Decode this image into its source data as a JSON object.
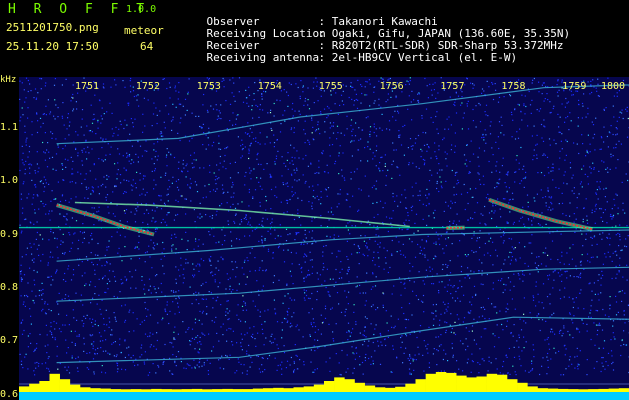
{
  "header": {
    "title": "H R O F F T",
    "version": "1.0.0",
    "filename": "2511201750.png",
    "datetime": "25.11.20 17:50",
    "meteor_label": "meteor",
    "meteor_count": "64"
  },
  "metadata": [
    {
      "key": "Observer",
      "value": ": Takanori Kawachi"
    },
    {
      "key": "Receiving Location",
      "value": ": Ogaki, Gifu, JAPAN (136.60E, 35.35N)"
    },
    {
      "key": "Receiver",
      "value": ": R820T2(RTL-SDR) SDR-Sharp 53.372MHz"
    },
    {
      "key": "Receiving antenna",
      "value": ": 2el-HB9CV Vertical (el. E-W)"
    }
  ],
  "colors": {
    "title": "#7CFC00",
    "labels": "#FFFF66",
    "text": "#FFFFFF",
    "background": "#06064e",
    "trace": "#00E0B0",
    "meteor_head": "#FF3030",
    "level_bar": "#FFFF00",
    "level_base": "#00CCFF"
  },
  "chart_data": {
    "type": "heatmap",
    "xlabel": "",
    "ylabel": "kHz",
    "x_ticks": [
      "1751",
      "1752",
      "1753",
      "1754",
      "1755",
      "1756",
      "1757",
      "1758",
      "1759",
      "1800"
    ],
    "y_ticks": [
      "1.1",
      "1.0",
      "0.9",
      "0.8",
      "0.7",
      "0.6"
    ],
    "ylim": [
      0.59,
      1.195
    ],
    "carrier_khz": 0.913,
    "horizontal_lines_khz": [
      0.913,
      0.62
    ],
    "traces": [
      {
        "points": [
          [
            0.0,
            1.07
          ],
          [
            2.0,
            1.08
          ],
          [
            4.0,
            1.12
          ],
          [
            6.0,
            1.145
          ],
          [
            8.0,
            1.175
          ],
          [
            9.3,
            1.18
          ],
          [
            10.0,
            1.18
          ]
        ]
      },
      {
        "points": [
          [
            0.0,
            0.85
          ],
          [
            2.5,
            0.87
          ],
          [
            4.5,
            0.89
          ],
          [
            6.0,
            0.9
          ],
          [
            8.0,
            0.905
          ],
          [
            10.0,
            0.91
          ]
        ]
      },
      {
        "points": [
          [
            0.0,
            0.775
          ],
          [
            3.0,
            0.79
          ],
          [
            6.0,
            0.82
          ],
          [
            8.0,
            0.835
          ],
          [
            10.0,
            0.84
          ]
        ]
      },
      {
        "points": [
          [
            0.0,
            0.66
          ],
          [
            3.0,
            0.67
          ],
          [
            4.3,
            0.69
          ],
          [
            6.0,
            0.72
          ],
          [
            7.5,
            0.745
          ],
          [
            10.0,
            0.74
          ]
        ]
      },
      {
        "points": [
          [
            0.3,
            0.96
          ],
          [
            1.5,
            0.955
          ],
          [
            3.0,
            0.945
          ],
          [
            4.5,
            0.93
          ],
          [
            5.8,
            0.915
          ]
        ]
      }
    ],
    "meteors": [
      {
        "points": [
          [
            0.0,
            0.955
          ],
          [
            0.6,
            0.935
          ],
          [
            1.1,
            0.915
          ],
          [
            1.6,
            0.9
          ]
        ]
      },
      {
        "points": [
          [
            7.1,
            0.965
          ],
          [
            7.6,
            0.945
          ],
          [
            8.2,
            0.925
          ],
          [
            8.8,
            0.91
          ]
        ]
      },
      {
        "points": [
          [
            6.4,
            0.912
          ],
          [
            6.7,
            0.913
          ]
        ]
      }
    ],
    "level_profile": [
      0.2,
      0.35,
      0.5,
      0.9,
      0.6,
      0.3,
      0.15,
      0.1,
      0.08,
      0.05,
      0.04,
      0.05,
      0.04,
      0.06,
      0.05,
      0.04,
      0.05,
      0.06,
      0.04,
      0.05,
      0.06,
      0.05,
      0.05,
      0.08,
      0.1,
      0.12,
      0.1,
      0.15,
      0.2,
      0.3,
      0.5,
      0.7,
      0.6,
      0.4,
      0.25,
      0.15,
      0.12,
      0.18,
      0.35,
      0.6,
      0.9,
      1.0,
      0.95,
      0.8,
      0.7,
      0.75,
      0.9,
      0.85,
      0.6,
      0.4,
      0.2,
      0.1,
      0.08,
      0.06,
      0.05,
      0.04,
      0.05,
      0.06,
      0.08,
      0.1
    ]
  }
}
